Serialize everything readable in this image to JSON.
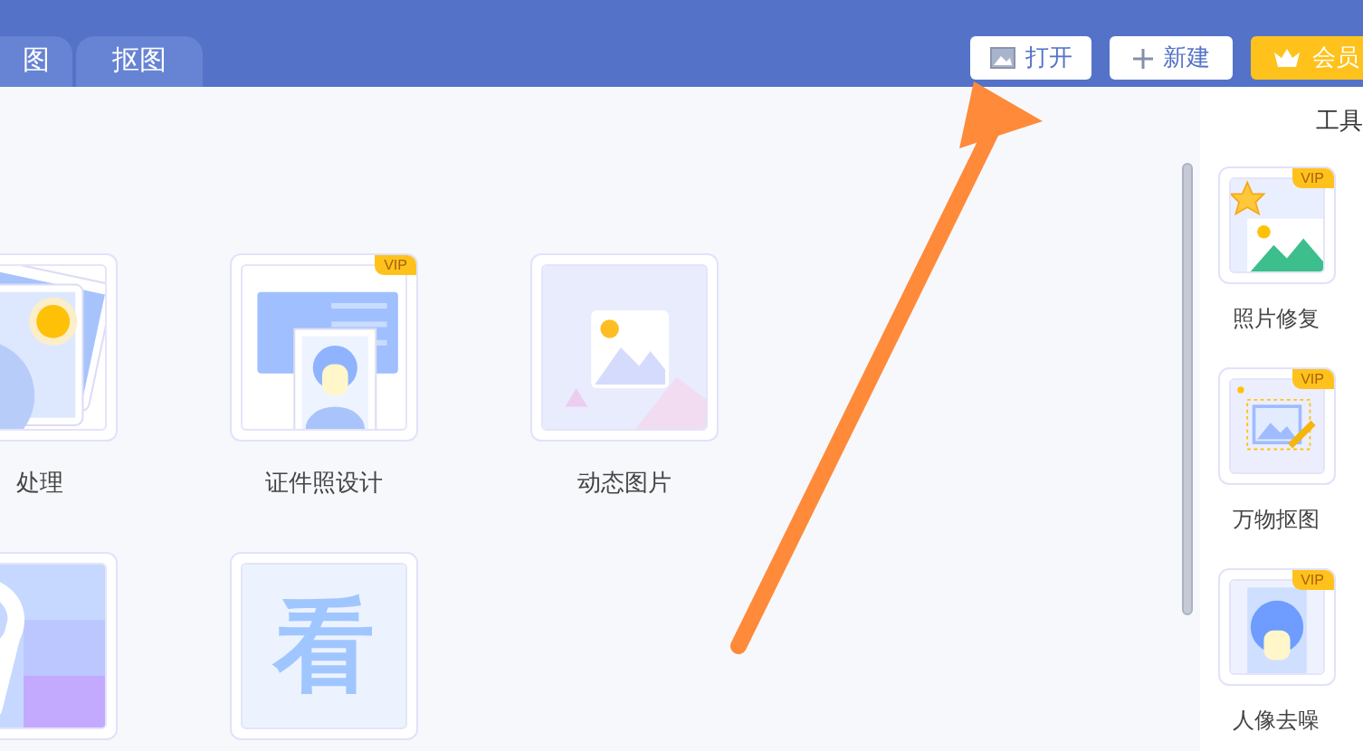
{
  "tabs": [
    {
      "label": "图",
      "selected": false
    },
    {
      "label": "抠图",
      "selected": false
    }
  ],
  "toolbar": {
    "buttons": [
      {
        "kind": "open",
        "label": "打开"
      },
      {
        "kind": "new",
        "label": "新建"
      },
      {
        "kind": "member",
        "label": "会员"
      }
    ]
  },
  "tiles": [
    {
      "kind": "photos",
      "label": "处理"
    },
    {
      "kind": "id-photo",
      "label": "证件照设计",
      "badge": "VIP"
    },
    {
      "kind": "animated",
      "label": "动态图片"
    },
    {
      "kind": "number"
    },
    {
      "kind": "glyph",
      "glyph": "看"
    }
  ],
  "side_panel": {
    "title": "工具",
    "tools": [
      {
        "kind": "repair",
        "label": "照片修复",
        "badge": "VIP"
      },
      {
        "kind": "cutout",
        "label": "万物抠图",
        "badge": "VIP"
      },
      {
        "kind": "portrait",
        "label": "人像去噪",
        "badge": "VIP"
      }
    ]
  }
}
